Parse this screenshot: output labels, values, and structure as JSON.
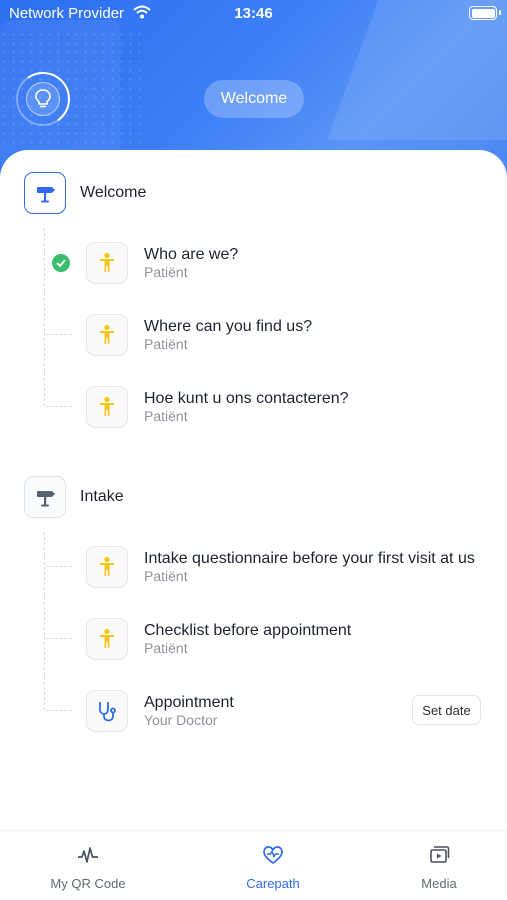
{
  "status_bar": {
    "carrier": "Network Provider",
    "time": "13:46"
  },
  "header": {
    "title": "Welcome"
  },
  "sections": [
    {
      "title": "Welcome",
      "items": [
        {
          "title": "Who are we?",
          "subtitle": "Patiënt",
          "completed": true
        },
        {
          "title": "Where can you find us?",
          "subtitle": "Patiënt"
        },
        {
          "title": "Hoe kunt u ons contacteren?",
          "subtitle": "Patiënt"
        }
      ]
    },
    {
      "title": "Intake",
      "items": [
        {
          "title": "Intake questionnaire before your first visit at us",
          "subtitle": "Patiënt"
        },
        {
          "title": "Checklist before appointment",
          "subtitle": "Patiënt"
        },
        {
          "title": "Appointment",
          "subtitle": "Your Doctor",
          "action": "Set date"
        }
      ]
    }
  ],
  "tabbar": {
    "tabs": [
      {
        "label": "My QR Code",
        "icon": "pulse-icon"
      },
      {
        "label": "Carepath",
        "icon": "heart-pulse-icon",
        "active": true
      },
      {
        "label": "Media",
        "icon": "media-icon"
      }
    ]
  },
  "colors": {
    "primary": "#2f6bea",
    "accent_yellow": "#f5c518",
    "success": "#3dbd6e"
  }
}
